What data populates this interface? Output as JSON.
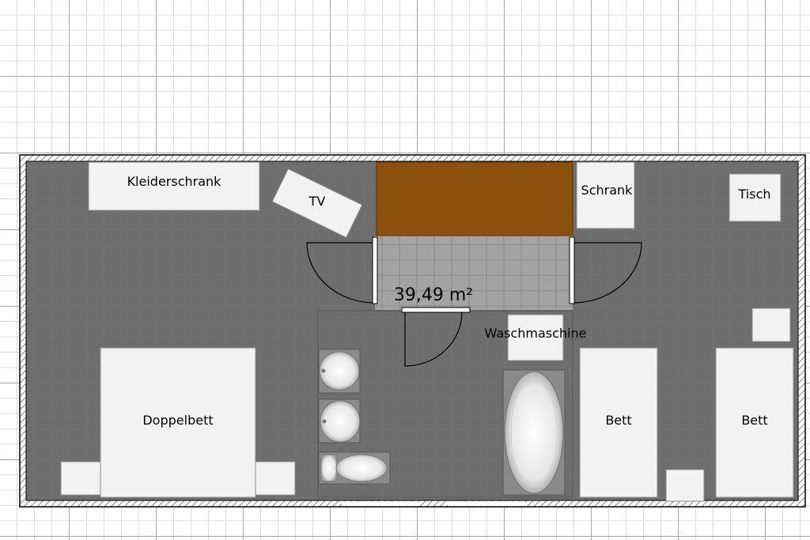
{
  "room": {
    "area": "39,49 m²",
    "colors": {
      "floor": "#6e6e6e",
      "corridor": "#a3a3a3",
      "wall": "#444444",
      "furniture": "#f2f2f2",
      "wood": "#8c500f"
    }
  },
  "labels": {
    "wardrobe": "Kleiderschrank",
    "tv": "TV",
    "cabinet": "Schrank",
    "table": "Tisch",
    "washer": "Waschmaschine",
    "double_bed": "Doppelbett",
    "bed_1": "Bett",
    "bed_2": "Bett"
  }
}
